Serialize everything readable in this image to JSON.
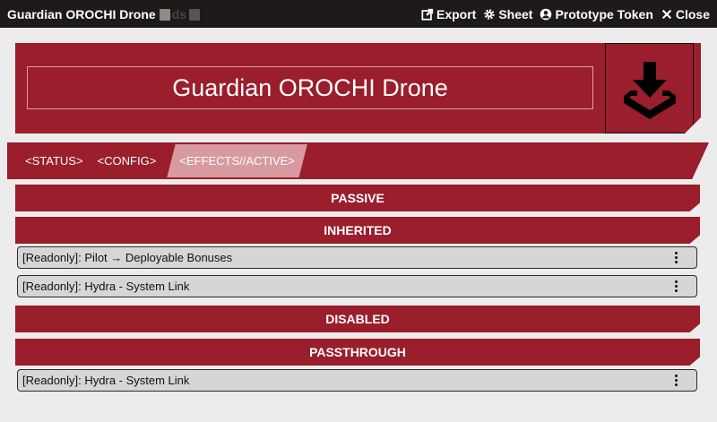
{
  "window": {
    "title": "Guardian OROCHI Drone",
    "ghost_text": "ds",
    "actions": [
      {
        "label": "Export",
        "icon": "external-link-icon"
      },
      {
        "label": "Sheet",
        "icon": "gear-icon"
      },
      {
        "label": "Prototype Token",
        "icon": "user-circle-icon"
      },
      {
        "label": "Close",
        "icon": "close-icon"
      }
    ]
  },
  "header": {
    "name": "Guardian OROCHI Drone",
    "image_icon": "download-tray-icon"
  },
  "tabs": [
    {
      "label": "<STATUS>",
      "active": false
    },
    {
      "label": "<CONFIG>",
      "active": false
    },
    {
      "label": "<EFFECTS//ACTIVE>",
      "active": true
    }
  ],
  "sections": {
    "passive": "PASSIVE",
    "inherited": "INHERITED",
    "disabled": "DISABLED",
    "passthrough": "PASSTHROUGH"
  },
  "inherited_effects": [
    {
      "label": "[Readonly]: Pilot → Deployable Bonuses"
    },
    {
      "label": "[Readonly]: Hydra - System Link"
    }
  ],
  "passthrough_effects": [
    {
      "label": "[Readonly]: Hydra - System Link"
    }
  ],
  "colors": {
    "accent": "#9a1e2b",
    "active_tab": "#d89aa1",
    "row_bg": "#d6d6d6",
    "page_bg": "#ececec",
    "header_bg": "#1d1a19"
  }
}
